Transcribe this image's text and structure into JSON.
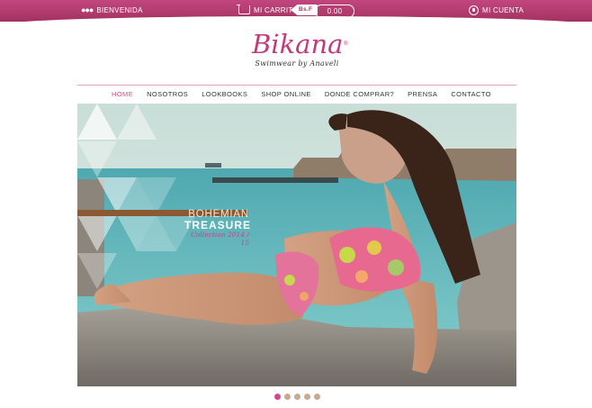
{
  "topbar": {
    "welcome": "BIENVENIDA",
    "cart_label": "MI CARRITO",
    "price_tag": "Bs.F",
    "cart_total": "0.00",
    "account_label": "MI CUENTA"
  },
  "logo": {
    "name": "Bikana",
    "registered": "®",
    "tagline": "Swimwear by Anaveli"
  },
  "nav": {
    "items": [
      "HOME",
      "NOSOTROS",
      "LOOKBOOKS",
      "SHOP ONLINE",
      "DONDE COMPRAR?",
      "PRENSA",
      "CONTACTO"
    ],
    "active_index": 0
  },
  "hero": {
    "line1": "BOHEMIAN",
    "line2": "TREASURE",
    "line3": "Collection 2014 / 15"
  },
  "slider": {
    "count": 5,
    "active_index": 0
  },
  "colors": {
    "brand": "#c4397a",
    "topbar": "#b03b6c",
    "active_dot": "#d8458c",
    "dot": "#c9a991"
  }
}
